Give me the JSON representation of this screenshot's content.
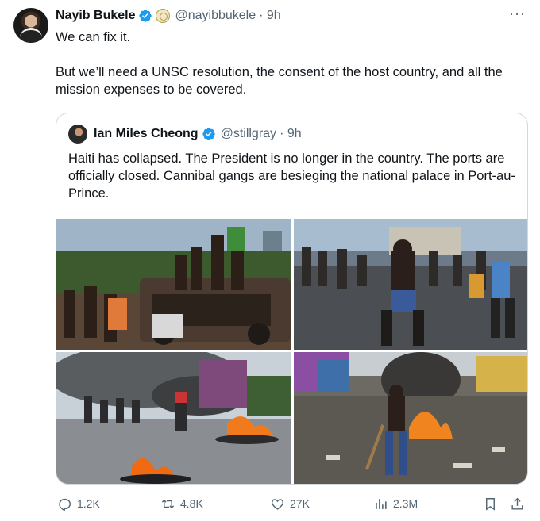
{
  "tweet": {
    "author_name": "Nayib Bukele",
    "author_handle": "@nayibbukele",
    "time": "· 9h",
    "more": "···",
    "text_p1": "We can fix it.",
    "text_p2": "But we’ll need a UNSC resolution, the consent of the host country, and all the mission expenses to be covered."
  },
  "quote": {
    "author_name": "Ian Miles Cheong",
    "author_handle": "@stillgray",
    "time": "· 9h",
    "text": "Haiti has collapsed. The President is no longer in the country. The ports are officially closed. Cannibal gangs are besieging the national palace in Port-au-Prince.",
    "photos": [
      {
        "name": "photo-crowd-on-burned-car"
      },
      {
        "name": "photo-man-running-with-machete"
      },
      {
        "name": "photo-burning-tires-street"
      },
      {
        "name": "photo-man-with-stick-fire"
      }
    ]
  },
  "actions": {
    "replies": "1.2K",
    "reposts": "4.8K",
    "likes": "27K",
    "views": "2.3M"
  },
  "colors": {
    "verified_blue": "#1d9bf0",
    "muted_text": "#536471",
    "border": "#cfd9de"
  },
  "icons": [
    "verified-icon",
    "government-badge-icon",
    "more-icon",
    "reply-icon",
    "repost-icon",
    "like-icon",
    "views-icon",
    "bookmark-icon",
    "share-icon"
  ]
}
